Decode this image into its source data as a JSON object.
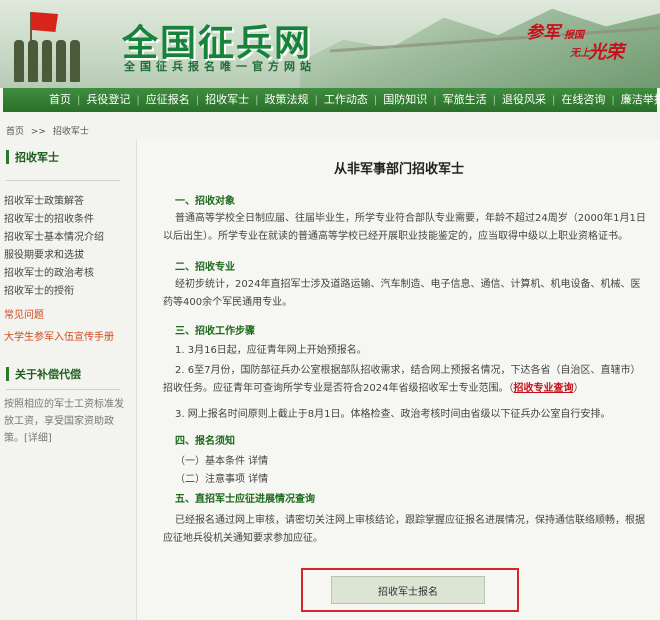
{
  "header": {
    "logo": "全国征兵网",
    "subtitle": "全国征兵报名唯一官方网站",
    "slogan": [
      "参军",
      "报国",
      "无上",
      "光荣"
    ]
  },
  "nav": [
    "首页",
    "兵役登记",
    "应征报名",
    "招收军士",
    "政策法规",
    "工作动态",
    "国防知识",
    "军旅生活",
    "退役风采",
    "在线咨询",
    "廉洁举报"
  ],
  "breadcrumb": {
    "home": "首页",
    "sep": ">>",
    "current": "招收军士"
  },
  "sidebar": {
    "section1_title": "招收军士",
    "links": [
      "招收军士政策解答",
      "招收军士的招收条件",
      "招收军士基本情况介绍",
      "服役期要求和选拔",
      "招收军士的政治考核",
      "招收军士的授衔"
    ],
    "faq": "常见问题",
    "handbook": "大学生参军入伍宣传手册",
    "section2_title": "关于补偿代偿",
    "section2_text": "按照相应的军士工资标准发放工资，享受国家资助政策。[详细]"
  },
  "main": {
    "title": "从非军事部门招收军士",
    "s1_title": "一、招收对象",
    "s1_p": "普通高等学校全日制应届、往届毕业生，所学专业符合部队专业需要，年龄不超过24周岁（2000年1月1日以后出生）。所学专业在就读的普通高等学校已经开展职业技能鉴定的，应当取得中级以上职业资格证书。",
    "s2_title": "二、招收专业",
    "s2_p": "经初步统计，2024年直招军士涉及道路运输、汽车制造、电子信息、通信、计算机、机电设备、机械、医药等400余个军民通用专业。",
    "s3_title": "三、招收工作步骤",
    "s3_p1": "1. 3月16日起，应征青年网上开始预报名。",
    "s3_p2": "2. 6至7月份，国防部征兵办公室根据部队招收需求，结合网上预报名情况，下达各省（自治区、直辖市）招收任务。应征青年可查询所学专业是否符合2024年省级招收军士专业范围。",
    "s3_link_open": "（",
    "s3_link": "招收专业查询",
    "s3_link_close": "）",
    "s3_p3": "3. 网上报名时间原则上截止于8月1日。体格检查、政治考核时间由省级以下征兵办公室自行安排。",
    "s4_title": "四、报名须知",
    "s4_item1": "（一）基本条件  详情",
    "s4_item2": "（二）注意事项  详情",
    "s5_title": "五、直招军士应征进展情况查询",
    "s5_p": "已经报名通过网上审核，请密切关注网上审核结论，跟踪掌握应征报名进展情况，保持通信联络顺畅，根据应征地兵役机关通知要求参加应征。",
    "apply_button": "招收军士报名"
  }
}
